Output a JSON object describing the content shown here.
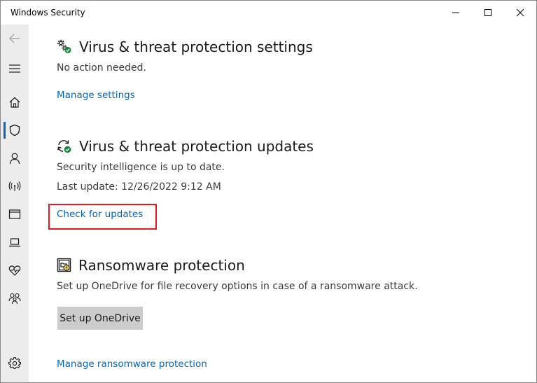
{
  "window": {
    "title": "Windows Security"
  },
  "colors": {
    "accent": "#0067c0",
    "highlight": "#e8171f",
    "status_ok": "#10893e"
  },
  "sidebar": {
    "items": [
      {
        "icon": "back-arrow-icon"
      },
      {
        "icon": "hamburger-menu-icon"
      },
      {
        "icon": "home-icon"
      },
      {
        "icon": "shield-icon",
        "active": true
      },
      {
        "icon": "person-icon"
      },
      {
        "icon": "wireless-icon"
      },
      {
        "icon": "app-browser-icon"
      },
      {
        "icon": "laptop-icon"
      },
      {
        "icon": "heart-pulse-icon"
      },
      {
        "icon": "family-icon"
      },
      {
        "icon": "gear-icon"
      }
    ]
  },
  "sections": {
    "settings": {
      "icon": "gears-check-icon",
      "heading": "Virus & threat protection settings",
      "status": "No action needed.",
      "link": "Manage settings"
    },
    "updates": {
      "icon": "refresh-check-icon",
      "heading": "Virus & threat protection updates",
      "status": "Security intelligence is up to date.",
      "last_update": "Last update: 12/26/2022 9:12 AM",
      "link": "Check for updates"
    },
    "ransomware": {
      "icon": "ransomware-folder-icon",
      "heading": "Ransomware protection",
      "description": "Set up OneDrive for file recovery options in case of a ransomware attack.",
      "button": "Set up OneDrive",
      "link": "Manage ransomware protection"
    }
  }
}
